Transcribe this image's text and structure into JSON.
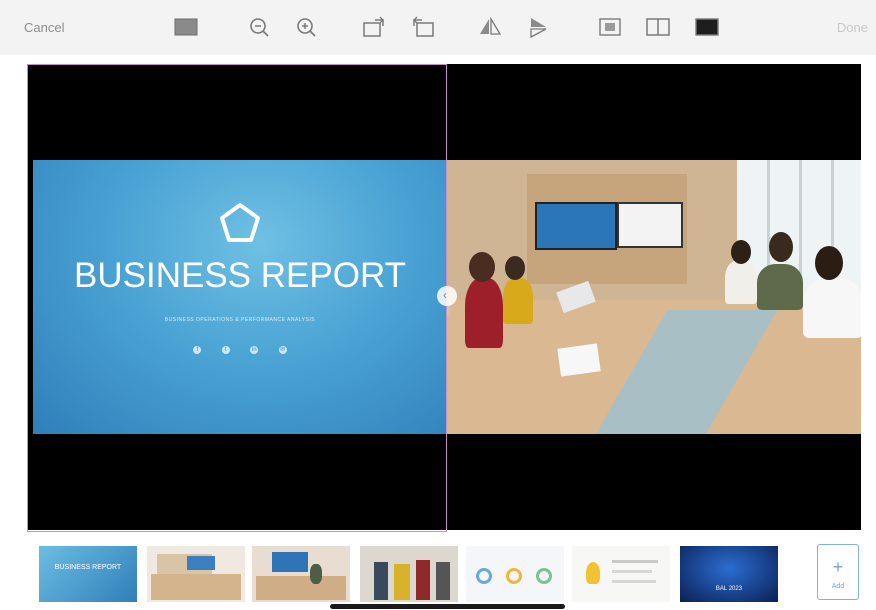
{
  "toolbar": {
    "cancel_label": "Cancel",
    "done_label": "Done",
    "icons": [
      "slide-layout-icon",
      "zoom-out-icon",
      "zoom-in-icon",
      "rotate-right-icon",
      "rotate-left-icon",
      "flip-horizontal-icon",
      "flip-vertical-icon",
      "fit-icon",
      "split-view-icon",
      "fill-icon"
    ]
  },
  "slide": {
    "title": "BUSINESS REPORT",
    "subtitle": "BUSINESS OPERATIONS & PERFORMANCE ANALYSIS",
    "social": [
      "f",
      "t",
      "in",
      "✉"
    ]
  },
  "thumbnails": {
    "count": 7,
    "add_label": "Add",
    "thumb1_title": "BUSINESS REPORT",
    "thumb7_title": "BAL 2023"
  },
  "colors": {
    "accent": "#7fb3dc",
    "selection": "#c78fc9",
    "slide_blue": "#4aa3d4"
  }
}
